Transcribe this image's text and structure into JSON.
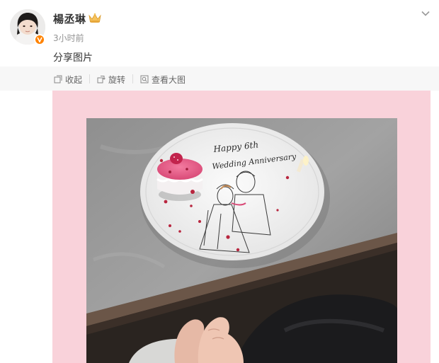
{
  "post": {
    "author": {
      "name": "楊丞琳",
      "avatar_icon": "avatar-portrait",
      "verified_icon": "verified-badge-icon",
      "badge_icon": "crown-icon"
    },
    "time": "3小时前",
    "text": "分享图片",
    "collapse_icon": "chevron-down-icon"
  },
  "toolbar": {
    "collect_label": "收起",
    "rotate_label": "旋转",
    "view_large_label": "查看大图"
  },
  "photo": {
    "plate_text_line1": "Happy 6th",
    "plate_text_line2": "Wedding Anniversary",
    "frame_color": "#f9d2da"
  },
  "colors": {
    "accent": "#ff8200",
    "meta_text": "#939393"
  }
}
